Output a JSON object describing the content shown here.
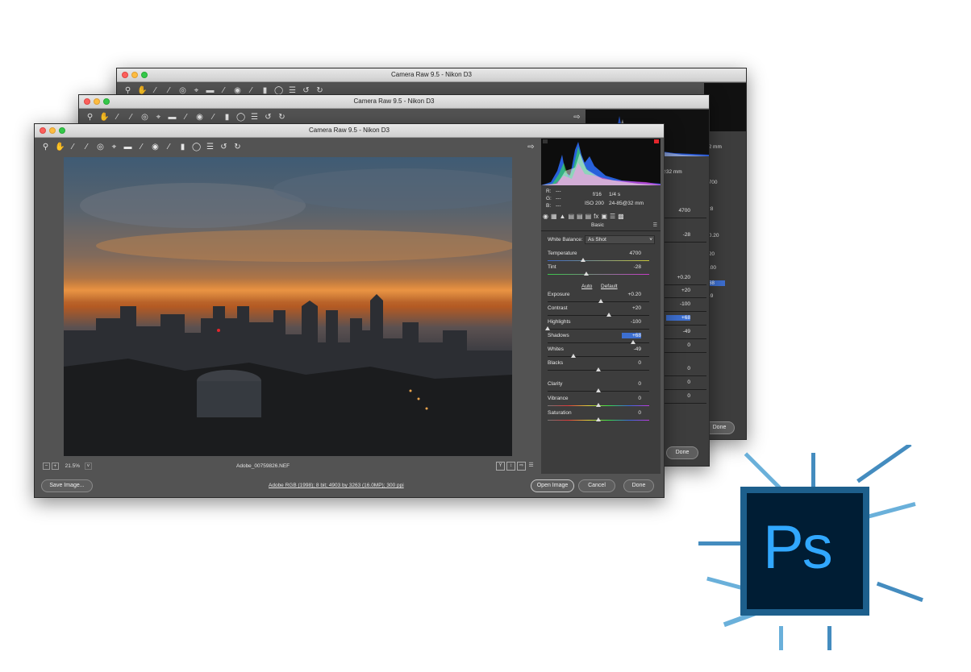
{
  "window": {
    "title": "Camera Raw 9.5  -  Nikon D3"
  },
  "toolbar": {
    "tools": [
      "zoom-icon",
      "hand-icon",
      "white-balance-icon",
      "color-sampler-icon",
      "targeted-adjust-icon",
      "crop-icon",
      "straighten-icon",
      "spot-removal-icon",
      "redeye-icon",
      "adjustment-brush-icon",
      "graduated-filter-icon",
      "radial-filter-icon",
      "presets-icon",
      "rotate-ccw-icon",
      "rotate-cw-icon"
    ],
    "export_icon": "export-icon"
  },
  "histogram": {
    "r_label": "R:",
    "g_label": "G:",
    "b_label": "B:",
    "r_value": "---",
    "g_value": "---",
    "b_value": "---",
    "aperture": "f/16",
    "shutter": "1/4 s",
    "iso": "ISO 200",
    "lens": "24-85@32 mm"
  },
  "panel": {
    "section_title": "Basic",
    "white_balance_label": "White Balance:",
    "white_balance_value": "As Shot",
    "auto_link": "Auto",
    "default_link": "Default",
    "sliders": [
      {
        "label": "Temperature",
        "value": "4700",
        "position": 0.35
      },
      {
        "label": "Tint",
        "value": "-28",
        "position": 0.38
      },
      {
        "label": "Exposure",
        "value": "+0.20",
        "position": 0.52
      },
      {
        "label": "Contrast",
        "value": "+20",
        "position": 0.6
      },
      {
        "label": "Highlights",
        "value": "-100",
        "position": 0.0
      },
      {
        "label": "Shadows",
        "value": "+68",
        "position": 0.84
      },
      {
        "label": "Whites",
        "value": "-49",
        "position": 0.25
      },
      {
        "label": "Blacks",
        "value": "0",
        "position": 0.5
      },
      {
        "label": "Clarity",
        "value": "0",
        "position": 0.5
      },
      {
        "label": "Vibrance",
        "value": "0",
        "position": 0.5
      },
      {
        "label": "Saturation",
        "value": "0",
        "position": 0.5
      }
    ]
  },
  "status": {
    "zoom": "21.5%",
    "filename": "Adobe_00759826.NEF",
    "workflow_info": "Adobe RGB (1998); 8 bit; 4903 by 3263 (16.0MP); 300 ppi"
  },
  "buttons": {
    "save_image": "Save Image...",
    "open_image": "Open Image",
    "cancel": "Cancel",
    "done": "Done"
  },
  "back_windows": {
    "values_mid": [
      "4700",
      "-28",
      "+0.20",
      "+20",
      "-100",
      "+68",
      "-49",
      "0",
      "0",
      "0",
      "0"
    ],
    "values_far": [
      "4700",
      "-28",
      "+0.20",
      "+20",
      "-100",
      "+68",
      "-49",
      "0",
      "0",
      "0"
    ],
    "lens": "32 mm",
    "lens_mid": "85@32 mm"
  },
  "logo": {
    "text": "Ps"
  }
}
